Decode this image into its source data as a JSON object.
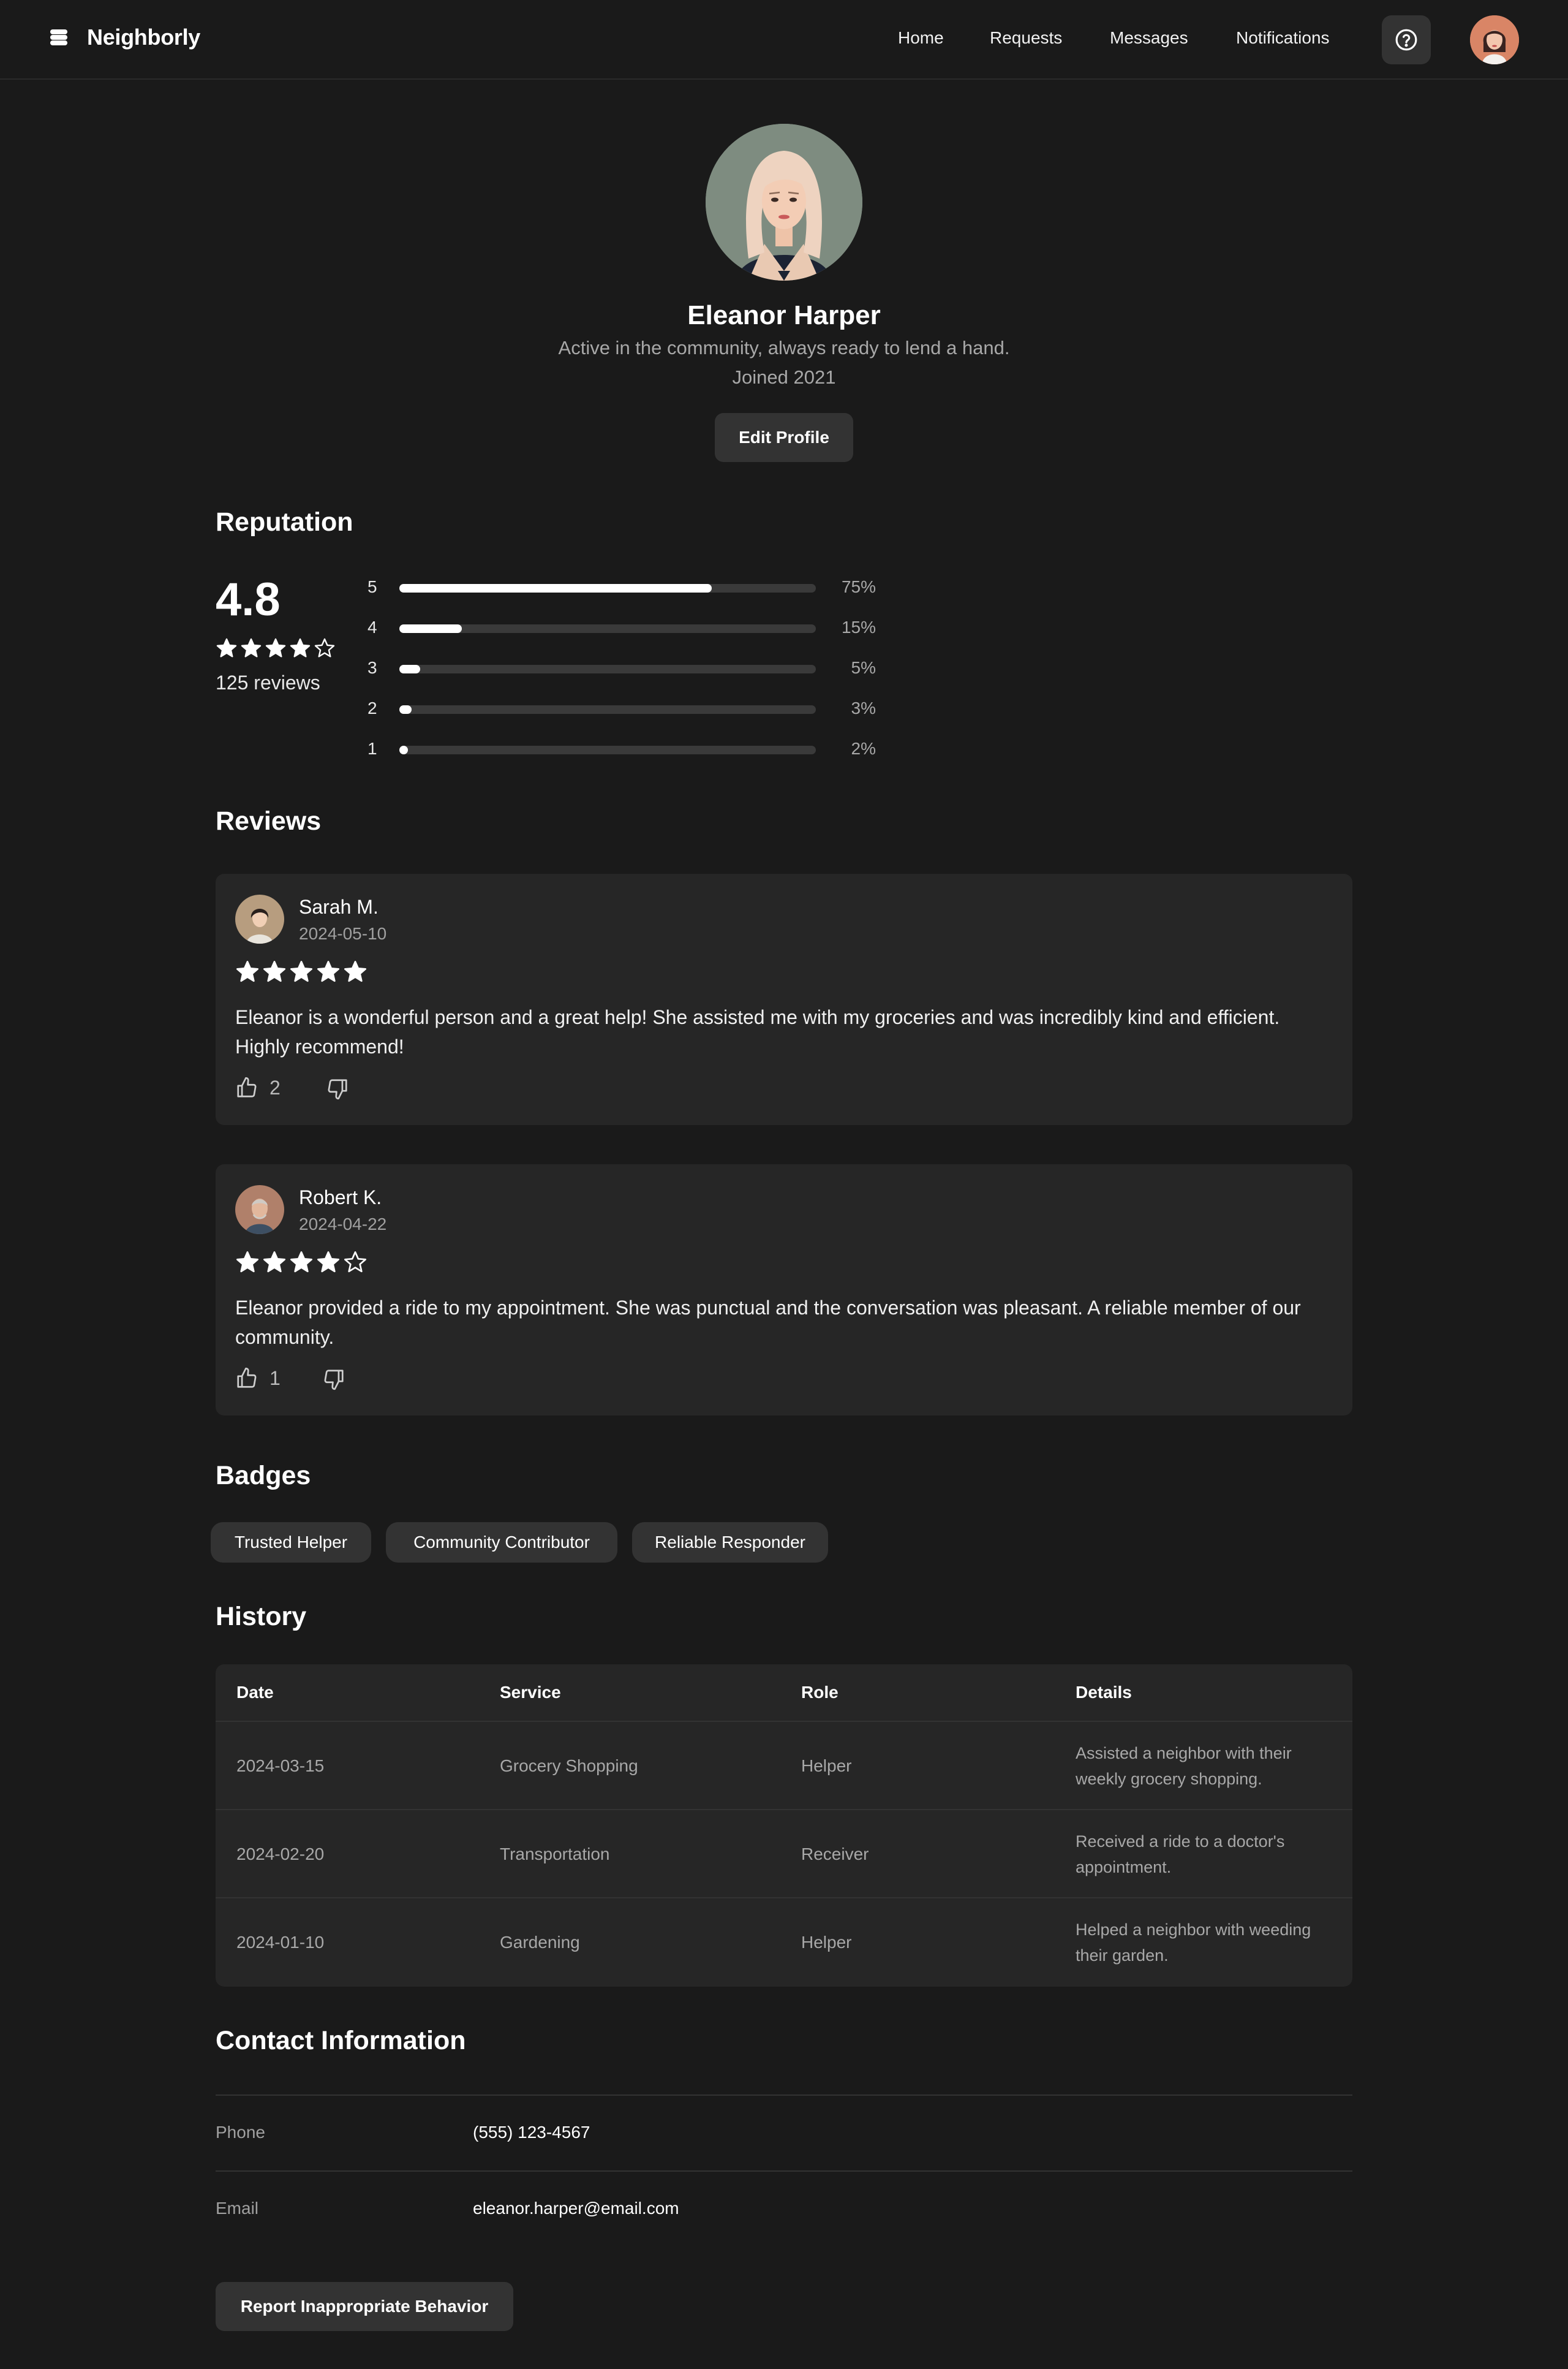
{
  "app": {
    "name": "Neighborly",
    "nav": [
      "Home",
      "Requests",
      "Messages",
      "Notifications"
    ]
  },
  "profile": {
    "name": "Eleanor Harper",
    "bio": "Active in the community, always ready to lend a hand.",
    "joined": "Joined 2021",
    "edit_label": "Edit Profile"
  },
  "reputation": {
    "title": "Reputation",
    "rating": "4.8",
    "rating_stars_filled": 4,
    "reviews_count": "125 reviews",
    "distribution": [
      {
        "stars": "5",
        "percent": 75,
        "label": "75%"
      },
      {
        "stars": "4",
        "percent": 15,
        "label": "15%"
      },
      {
        "stars": "3",
        "percent": 5,
        "label": "5%"
      },
      {
        "stars": "2",
        "percent": 3,
        "label": "3%"
      },
      {
        "stars": "1",
        "percent": 2,
        "label": "2%"
      }
    ]
  },
  "reviews": {
    "title": "Reviews",
    "items": [
      {
        "name": "Sarah M.",
        "date": "2024-05-10",
        "stars": 5,
        "text": "Eleanor is a wonderful person and a great help! She assisted me with my groceries and was incredibly kind and efficient. Highly recommend!",
        "likes": "2"
      },
      {
        "name": "Robert K.",
        "date": "2024-04-22",
        "stars": 4,
        "text": "Eleanor provided a ride to my appointment. She was punctual and the conversation was pleasant. A reliable member of our community.",
        "likes": "1"
      }
    ]
  },
  "badges": {
    "title": "Badges",
    "items": [
      "Trusted Helper",
      "Community Contributor",
      "Reliable Responder"
    ]
  },
  "history": {
    "title": "History",
    "columns": [
      "Date",
      "Service",
      "Role",
      "Details"
    ],
    "rows": [
      {
        "date": "2024-03-15",
        "service": "Grocery Shopping",
        "role": "Helper",
        "details": "Assisted a neighbor with their weekly grocery shopping."
      },
      {
        "date": "2024-02-20",
        "service": "Transportation",
        "role": "Receiver",
        "details": "Received a ride to a doctor's appointment."
      },
      {
        "date": "2024-01-10",
        "service": "Gardening",
        "role": "Helper",
        "details": "Helped a neighbor with weeding their garden."
      }
    ]
  },
  "contact": {
    "title": "Contact Information",
    "phone_label": "Phone",
    "phone": "(555) 123-4567",
    "email_label": "Email",
    "email": "eleanor.harper@email.com"
  },
  "report_label": "Report Inappropriate Behavior",
  "icons": {
    "logo": "stack-icon",
    "help": "help-circle-icon",
    "like": "thumbs-up-icon",
    "dislike": "thumbs-down-icon",
    "star": "star-icon"
  },
  "colors": {
    "background": "#1a1a1a",
    "card": "#262626",
    "button": "#333333",
    "text": "#ffffff",
    "muted": "#a8a8a8"
  }
}
